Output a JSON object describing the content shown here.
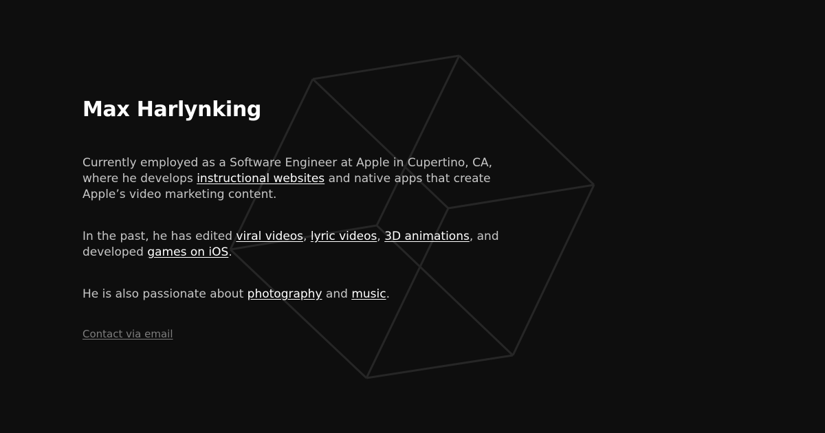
{
  "header": {
    "name": "Max Harlynking"
  },
  "intro": {
    "text_before": "Currently employed as a Software Engineer at Apple in Cupertino, CA, where he develops ",
    "link_instructional_websites": "instructional websites",
    "text_after": " and native apps that create Apple’s video marketing content."
  },
  "past": {
    "text_before": "In the past, he has edited ",
    "link_viral_videos": "viral videos",
    "sep1": ", ",
    "link_lyric_videos": "lyric videos",
    "sep2": ", ",
    "link_3d_animations": "3D animations",
    "text_middle": ", and developed ",
    "link_games_ios": "games on iOS",
    "text_end": "."
  },
  "passions": {
    "text_before": "He is also passionate about ",
    "link_photography": "photography",
    "text_and": " and ",
    "link_music": "music",
    "text_end": "."
  },
  "contact": {
    "label": "Contact via email"
  },
  "colors": {
    "background": "#0e0e0e",
    "text": "#c6c6c6",
    "heading": "#ffffff",
    "link": "#ffffff",
    "muted_link": "#7d7d7d",
    "cube_lines": "#262626"
  }
}
